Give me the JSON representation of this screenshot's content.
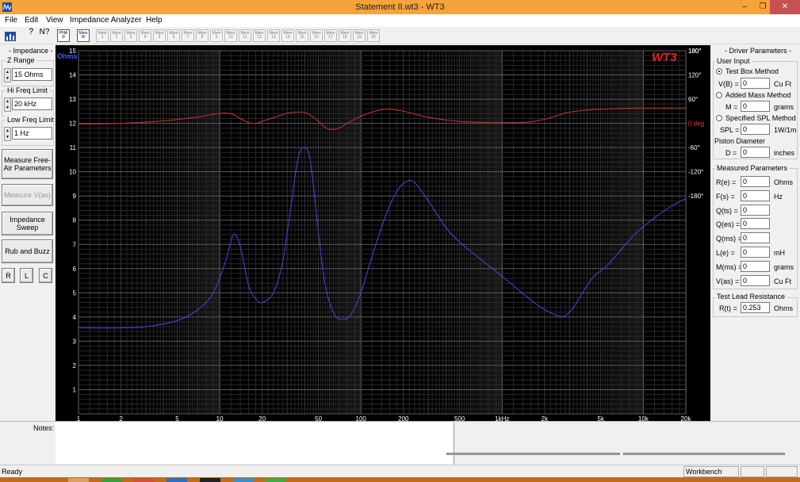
{
  "window": {
    "title": "Statement II.wt3 - WT3",
    "controls": [
      "–",
      "❐",
      "✕"
    ]
  },
  "menu": [
    "File",
    "Edit",
    "View",
    "Impedance Analyzer",
    "Help"
  ],
  "toolbar": {
    "pha_label": "PHA",
    "mem_label": "Mem",
    "mem_sub": "W",
    "memory_slots": [
      "Mem\n1",
      "Mem\n2",
      "Mem\n3",
      "Mem\n4",
      "Mem\n5",
      "Mem\n6",
      "Mem\n7",
      "Mem\n8",
      "Mem\n9",
      "Mem\n10",
      "Mem\n11",
      "Mem\n12",
      "Mem\n13",
      "Mem\n14",
      "Mem\n15",
      "Mem\n16",
      "Mem\n17",
      "Mem\n18",
      "Mem\n19",
      "Mem\n20"
    ]
  },
  "impedance": {
    "title": "- Impedance -",
    "z_range": {
      "label": "Z Range",
      "value": "15 Ohms"
    },
    "hi_freq": {
      "label": "Hi Freq Limit",
      "value": "20 kHz"
    },
    "low_freq": {
      "label": "Low Freq Limit",
      "value": "1 Hz"
    },
    "buttons": {
      "measure_free_air": "Measure Free-Air Parameters",
      "measure_vas": "Measure V(as)",
      "impedance_sweep": "Impedance Sweep",
      "rub_buzz": "Rub and Buzz",
      "r": "R",
      "l": "L",
      "c": "C"
    }
  },
  "chart_data": {
    "type": "line",
    "logo": "WT3",
    "y_unit_label": "Ohms",
    "y2_unit_label": "deg",
    "xscale": "log",
    "xlim": [
      1,
      20000
    ],
    "ylim": [
      0,
      15
    ],
    "y2lim": [
      -180,
      180
    ],
    "y2_extra_top": 180,
    "x_ticks": [
      {
        "v": 1,
        "t": "1"
      },
      {
        "v": 2,
        "t": "2"
      },
      {
        "v": 5,
        "t": "5"
      },
      {
        "v": 10,
        "t": "10"
      },
      {
        "v": 20,
        "t": "20"
      },
      {
        "v": 50,
        "t": "50"
      },
      {
        "v": 100,
        "t": "100"
      },
      {
        "v": 200,
        "t": "200"
      },
      {
        "v": 500,
        "t": "500"
      },
      {
        "v": 1000,
        "t": "1kHz"
      },
      {
        "v": 2000,
        "t": "2k"
      },
      {
        "v": 5000,
        "t": "5k"
      },
      {
        "v": 10000,
        "t": "10k"
      },
      {
        "v": 20000,
        "t": "20k"
      }
    ],
    "y_ticks": [
      "1",
      "2",
      "3",
      "4",
      "5",
      "6",
      "7",
      "8",
      "9",
      "10",
      "11",
      "12",
      "13",
      "14",
      "15"
    ],
    "y2_ticks": [
      {
        "v": 180,
        "t": "180°"
      },
      {
        "v": 120,
        "t": "120°"
      },
      {
        "v": 60,
        "t": "60°"
      },
      {
        "v": 0,
        "t": "0 deg"
      },
      {
        "v": -60,
        "t": "-60°"
      },
      {
        "v": -120,
        "t": "-120°"
      },
      {
        "v": -180,
        "t": "-180°"
      }
    ],
    "grid": true,
    "series": [
      {
        "color": "#4646e6",
        "axis": "left",
        "x": [
          1,
          2,
          3,
          5,
          7,
          9,
          11,
          12.5,
          14,
          16,
          18,
          20,
          24,
          28,
          32,
          36,
          40,
          44,
          50,
          56,
          65,
          75,
          85,
          100,
          120,
          150,
          180,
          210,
          240,
          300,
          400,
          500,
          700,
          900,
          1200,
          1600,
          2000,
          2500,
          2800,
          3200,
          3800,
          4500,
          5500,
          7000,
          9000,
          12000,
          15000,
          20000
        ],
        "y": [
          3.55,
          3.55,
          3.6,
          3.85,
          4.3,
          5.0,
          6.3,
          7.4,
          6.9,
          5.3,
          4.75,
          4.6,
          5.0,
          6.3,
          8.6,
          10.6,
          11.0,
          10.4,
          7.5,
          5.3,
          4.1,
          3.9,
          4.1,
          5.0,
          6.5,
          8.2,
          9.2,
          9.6,
          9.55,
          8.8,
          7.7,
          7.1,
          6.4,
          5.9,
          5.3,
          4.7,
          4.3,
          4.05,
          4.05,
          4.4,
          5.1,
          5.7,
          6.1,
          6.8,
          7.5,
          8.1,
          8.5,
          8.9
        ]
      },
      {
        "color": "#d03030",
        "axis": "right",
        "x": [
          1,
          2,
          4,
          7,
          10,
          12,
          14,
          16,
          18,
          20,
          25,
          30,
          35,
          40,
          45,
          50,
          55,
          60,
          70,
          80,
          100,
          120,
          150,
          200,
          300,
          500,
          800,
          1000,
          1500,
          2000,
          2500,
          3000,
          5000,
          10000,
          20000
        ],
        "y": [
          -2,
          0,
          6,
          16,
          25,
          24,
          12,
          2,
          0,
          5,
          16,
          25,
          28,
          27,
          18,
          5,
          -8,
          -15,
          -12,
          0,
          18,
          28,
          35,
          30,
          15,
          5,
          2,
          2,
          3,
          10,
          20,
          28,
          35,
          38,
          38
        ]
      }
    ]
  },
  "driver": {
    "title": "- Driver Parameters -",
    "user_input": {
      "title": "User Input",
      "test_box": "Test Box Method",
      "vb_label": "V(B) =",
      "vb_value": "0",
      "vb_unit": "Cu Ft",
      "added_mass": "Added Mass Method",
      "m_label": "M =",
      "m_value": "0",
      "m_unit": "grams",
      "spl_method": "Specified SPL Method",
      "spl_label": "SPL =",
      "spl_value": "0",
      "spl_unit": "1W/1m",
      "piston_label": "Piston Diameter",
      "d_label": "D =",
      "d_value": "0",
      "d_unit": "inches"
    },
    "measured": {
      "title": "Measured Parameters",
      "rows": [
        {
          "label": "R(e) =",
          "value": "0",
          "unit": "Ohms"
        },
        {
          "label": "F(s) =",
          "value": "0",
          "unit": "Hz"
        },
        {
          "label": "Q(ts) =",
          "value": "0",
          "unit": ""
        },
        {
          "label": "Q(es) =",
          "value": "0",
          "unit": ""
        },
        {
          "label": "Q(ms) =",
          "value": "0",
          "unit": ""
        },
        {
          "label": "L(e) =",
          "value": "0",
          "unit": "mH"
        },
        {
          "label": "M(ms) =",
          "value": "0",
          "unit": "grams"
        },
        {
          "label": "V(as) =",
          "value": "0",
          "unit": "Cu Ft"
        }
      ]
    },
    "lead": {
      "title": "Test Lead Resistance",
      "label": "R(t) =",
      "value": "0.253",
      "unit": "Ohms"
    }
  },
  "notes": {
    "label": "Notes:"
  },
  "status": {
    "left": "Ready",
    "workbench": "Workbench"
  }
}
